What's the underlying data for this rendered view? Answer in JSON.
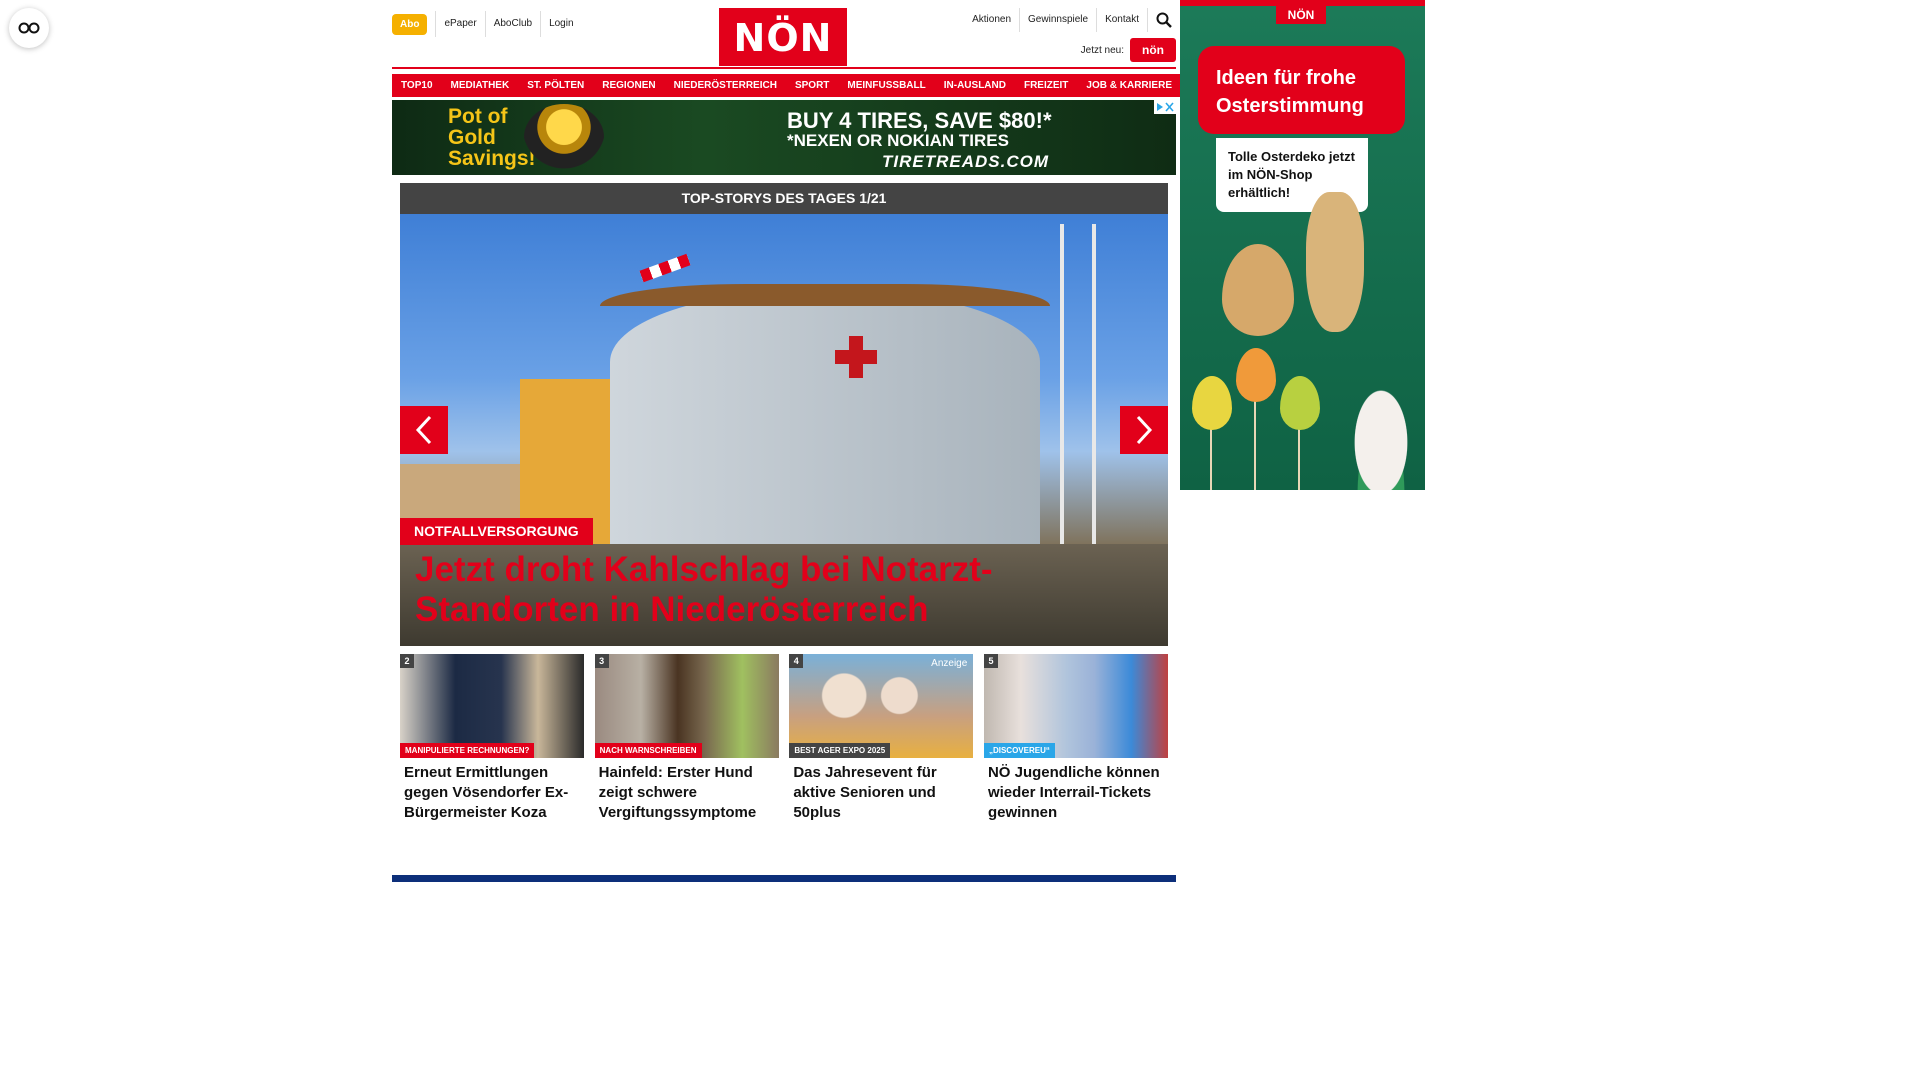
{
  "header": {
    "abo_label": "Abo",
    "left_links": [
      "ePaper",
      "AboClub",
      "Login"
    ],
    "logo_text": "NÖN",
    "right_links": [
      "Aktionen",
      "Gewinnspiele",
      "Kontakt"
    ],
    "jetzt_neu_label": "Jetzt neu:",
    "jetzt_neu_badge": "nön"
  },
  "nav": {
    "items": [
      "TOP10",
      "MEDIATHEK",
      "ST. PÖLTEN",
      "REGIONEN",
      "NIEDERÖSTERREICH",
      "SPORT",
      "MEINFUSSBALL",
      "IN-AUSLAND",
      "FREIZEIT",
      "JOB & KARRIERE"
    ]
  },
  "ad_banner": {
    "left_text": "Pot of Gold Savings!",
    "headline": "BUY 4 TIRES, SAVE $80!*",
    "subline": "*NEXEN OR NOKIAN TIRES",
    "brand": "TIRETREADS.COM"
  },
  "hero": {
    "header": "TOP-STORYS DES TAGES 1/21",
    "kicker": "NOTFALLVERSORGUNG",
    "title": "Jetzt droht Kahlschlag bei Notarzt-Standorten in Niederösterreich"
  },
  "teasers": [
    {
      "num": "2",
      "tag": "MANIPULIERTE RECHNUNGEN?",
      "title": "Erneut Ermittlungen gegen Vösendorfer Ex-Bürgermeister Koza",
      "anzeige": ""
    },
    {
      "num": "3",
      "tag": "NACH WARNSCHREIBEN",
      "title": "Hainfeld: Erster Hund zeigt schwere Vergiftungssymptome",
      "anzeige": ""
    },
    {
      "num": "4",
      "tag": "BEST AGER EXPO 2025",
      "title": "Das Jahresevent für aktive Senioren und 50plus",
      "anzeige": "Anzeige"
    },
    {
      "num": "5",
      "tag": "„DISCOVEREU“",
      "title": "NÖ Jugendliche können wieder Interrail-Tickets gewinnen",
      "anzeige": ""
    }
  ],
  "side_ad": {
    "tab": "NÖN",
    "headline": "Ideen für frohe Osterstimmung",
    "card_text": "Tolle Osterdeko jetzt im NÖN-Shop erhältlich!"
  },
  "colors": {
    "brand_red": "#e2001a",
    "abo_yellow": "#f5b000",
    "footer_blue": "#0d2f7a",
    "hero_header_gray": "#444444",
    "side_ad_green": "#1c7a58"
  }
}
